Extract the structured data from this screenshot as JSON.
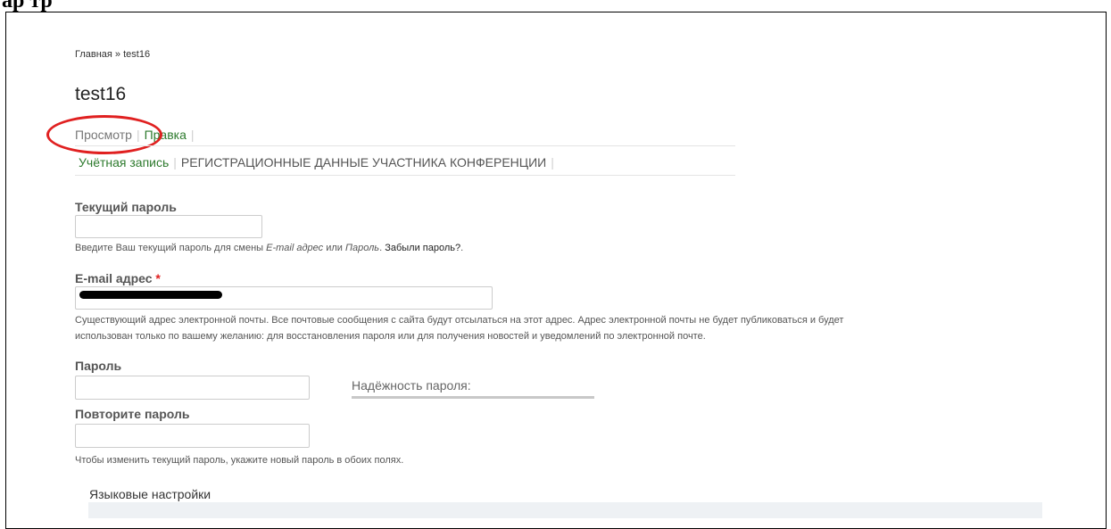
{
  "breadcrumb": "Главная » test16",
  "page_title": "test16",
  "tabs": {
    "view": "Просмотр",
    "edit": "Правка"
  },
  "subtabs": {
    "account": "Учётная запись",
    "conference": "РЕГИСТРАЦИОННЫЕ ДАННЫЕ УЧАСТНИКА КОНФЕРЕНЦИИ"
  },
  "current_password": {
    "label": "Текущий пароль",
    "description": {
      "prefix": "Введите Ваш текущий пароль для смены ",
      "em1": "E-mail адрес",
      "mid": " или ",
      "em2": "Пароль",
      "dot": ". ",
      "link": "Забыли пароль?",
      "end": "."
    }
  },
  "email": {
    "label": "E-mail адрес",
    "required_mark": "*",
    "description_line1": "Существующий адрес электронной почты. Все почтовые сообщения с сайта будут отсылаться на этот адрес. Адрес электронной почты не будет публиковаться и будет",
    "description_line2": "использован только по вашему желанию: для восстановления пароля или для получения новостей и уведомлений по электронной почте."
  },
  "password": {
    "label": "Пароль",
    "strength_label": "Надёжность пароля:"
  },
  "confirm_password": {
    "label": "Повторите пароль",
    "description": "Чтобы изменить текущий пароль, укажите новый пароль в обоих полях."
  },
  "language": {
    "title": "Языковые настройки"
  },
  "colors": {
    "link_green": "#2d7a2d",
    "annotation_red": "#e02020",
    "required_red": "#e02020"
  }
}
